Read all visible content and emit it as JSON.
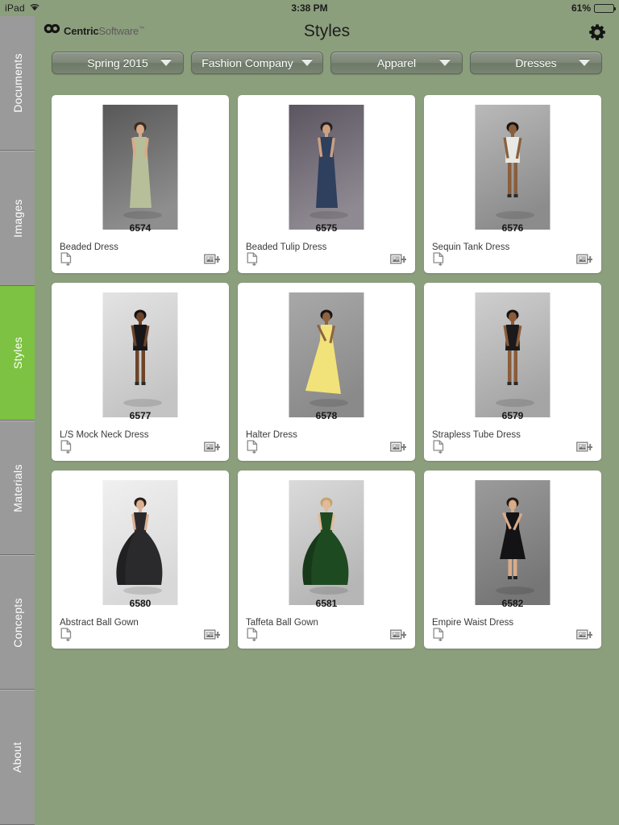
{
  "status_bar": {
    "device": "iPad",
    "wifi_icon": "wifi-icon",
    "time": "3:38 PM",
    "battery_percent": "61%",
    "battery_level": 61
  },
  "header": {
    "logo_mark": "centric-co-logo-icon",
    "logo_primary": "Centric",
    "logo_secondary": "Software",
    "logo_trademark": "™",
    "title": "Styles",
    "settings_icon": "gear-icon"
  },
  "sidebar": {
    "items": [
      {
        "label": "Documents",
        "active": false
      },
      {
        "label": "Images",
        "active": false
      },
      {
        "label": "Styles",
        "active": true
      },
      {
        "label": "Materials",
        "active": false
      },
      {
        "label": "Concepts",
        "active": false
      },
      {
        "label": "About",
        "active": false
      }
    ],
    "active_color": "#7dc242",
    "inactive_color": "#9a9a9a"
  },
  "filters": [
    {
      "name": "season-filter",
      "value": "Spring 2015",
      "caret_icon": "chevron-down-icon"
    },
    {
      "name": "company-filter",
      "value": "Fashion Company",
      "caret_icon": "chevron-down-icon"
    },
    {
      "name": "category-filter",
      "value": "Apparel",
      "caret_icon": "chevron-down-icon"
    },
    {
      "name": "subcategory-filter",
      "value": "Dresses",
      "caret_icon": "chevron-down-icon"
    }
  ],
  "card_actions": {
    "add_document_icon": "document-add-icon",
    "add_image_icon": "image-add-icon"
  },
  "styles": [
    {
      "id": "6574",
      "name": "Beaded Dress",
      "dress": "#b7bf9a",
      "skin": "#d7ab88",
      "hair": "#3a2a20",
      "shape": "gown",
      "bg_top": "#585858",
      "bg_bottom": "#8e8e8e"
    },
    {
      "id": "6575",
      "name": "Beaded Tulip Dress",
      "dress": "#2f3f5e",
      "skin": "#caa183",
      "hair": "#27201c",
      "shape": "gown",
      "bg_top": "#5b5560",
      "bg_bottom": "#8f8a92"
    },
    {
      "id": "6576",
      "name": "Sequin Tank Dress",
      "dress": "#e8e8e4",
      "skin": "#8a5e3c",
      "hair": "#1a1410",
      "shape": "short",
      "bg_top": "#b9b9b9",
      "bg_bottom": "#8c8c8c"
    },
    {
      "id": "6577",
      "name": "L/S Mock Neck Dress",
      "dress": "#17171a",
      "skin": "#6d4427",
      "hair": "#141014",
      "shape": "short",
      "bg_top": "#e3e3e3",
      "bg_bottom": "#c4c4c4"
    },
    {
      "id": "6578",
      "name": "Halter Dress",
      "dress": "#f2e27a",
      "skin": "#8e6341",
      "hair": "#171313",
      "shape": "flowing",
      "bg_top": "#a8a8a8",
      "bg_bottom": "#8a8a8a"
    },
    {
      "id": "6579",
      "name": "Strapless Tube Dress",
      "dress": "#1a1a1c",
      "skin": "#8a5c39",
      "hair": "#17120f",
      "shape": "short",
      "bg_top": "#cfcfcf",
      "bg_bottom": "#a5a5a5"
    },
    {
      "id": "6580",
      "name": "Abstract Ball Gown",
      "dress": "#2a2a2c",
      "skin": "#dcb094",
      "hair": "#2a1d16",
      "shape": "ballgown",
      "bg_top": "#f0f0f0",
      "bg_bottom": "#d8d8d8"
    },
    {
      "id": "6581",
      "name": "Taffeta Ball Gown",
      "dress": "#1e4a22",
      "skin": "#e0bb9b",
      "hair": "#c7a46a",
      "shape": "ballgown",
      "bg_top": "#dadada",
      "bg_bottom": "#b6b6b6"
    },
    {
      "id": "6582",
      "name": "Empire Waist Dress",
      "dress": "#131316",
      "skin": "#d8ab88",
      "hair": "#241a14",
      "shape": "midi",
      "bg_top": "#9b9b9b",
      "bg_bottom": "#767676"
    }
  ],
  "theme": {
    "background": "#8c9f7d",
    "card_background": "#ffffff",
    "accent_green": "#7dc242"
  }
}
